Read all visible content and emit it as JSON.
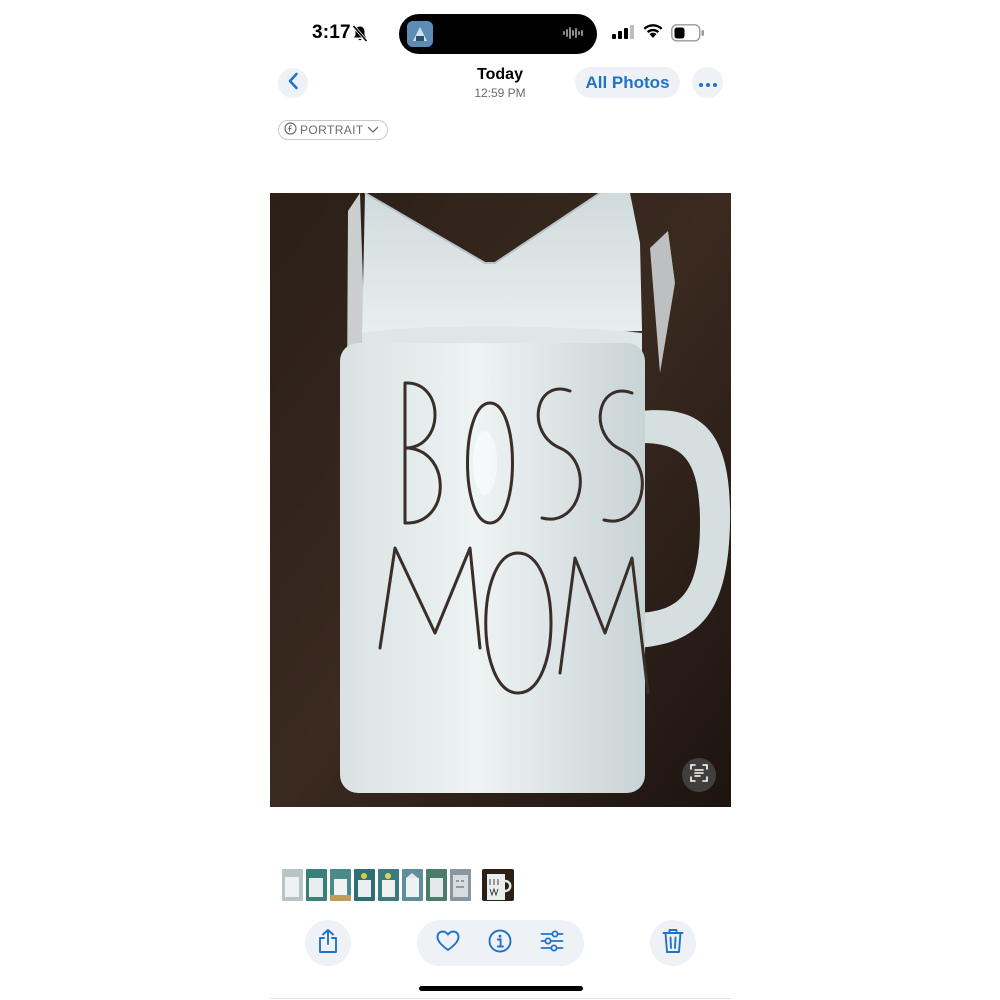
{
  "status_bar": {
    "time": "3:17",
    "bell_icon": "bell-slash-icon",
    "signal_icon": "cellular-signal-icon",
    "wifi_icon": "wifi-icon",
    "battery_icon": "battery-icon"
  },
  "nav": {
    "back_icon": "chevron-left-icon",
    "title": "Today",
    "subtitle": "12:59 PM",
    "all_photos_label": "All Photos",
    "more_icon": "ellipsis-icon"
  },
  "portrait_badge": {
    "label": "PORTRAIT",
    "icon": "aperture-icon",
    "chevron": "chevron-down-icon"
  },
  "photo": {
    "description_text_line1": "BOSS",
    "description_text_line2": "MOM",
    "live_text_icon": "live-text-icon"
  },
  "filmstrip": {
    "thumbnail_count": 9,
    "current_index": 8
  },
  "toolbar": {
    "share_icon": "share-icon",
    "favorite_icon": "heart-icon",
    "info_icon": "info-icon",
    "adjust_icon": "sliders-icon",
    "delete_icon": "trash-icon"
  },
  "colors": {
    "accent": "#1f74c9",
    "button_bg": "#eef1f5",
    "photo_bg": "#2a1e17"
  }
}
